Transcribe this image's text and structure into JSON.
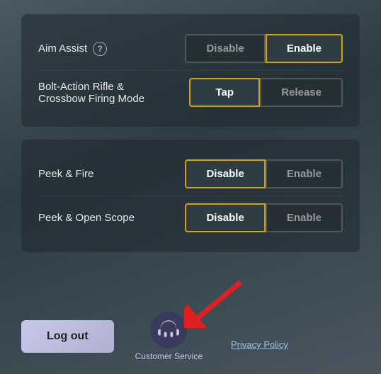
{
  "settings": {
    "aim_assist": {
      "label": "Aim Assist",
      "has_help": true,
      "options": [
        {
          "id": "disable",
          "label": "Disable",
          "active": false
        },
        {
          "id": "enable",
          "label": "Enable",
          "active": true
        }
      ]
    },
    "bolt_action": {
      "label_line1": "Bolt-Action Rifle &",
      "label_line2": "Crossbow Firing Mode",
      "options": [
        {
          "id": "tap",
          "label": "Tap",
          "active": true
        },
        {
          "id": "release",
          "label": "Release",
          "active": false
        }
      ]
    },
    "peek_fire": {
      "label": "Peek & Fire",
      "options": [
        {
          "id": "disable",
          "label": "Disable",
          "active": true
        },
        {
          "id": "enable",
          "label": "Enable",
          "active": false
        }
      ]
    },
    "peek_scope": {
      "label": "Peek & Open Scope",
      "options": [
        {
          "id": "disable",
          "label": "Disable",
          "active": true
        },
        {
          "id": "enable",
          "label": "Enable",
          "active": false
        }
      ]
    }
  },
  "bottom": {
    "logout_label": "Log out",
    "customer_service_label": "Customer Service",
    "privacy_policy_label": "Privacy Policy"
  },
  "help_icon_label": "?",
  "arrow_label": "▶"
}
